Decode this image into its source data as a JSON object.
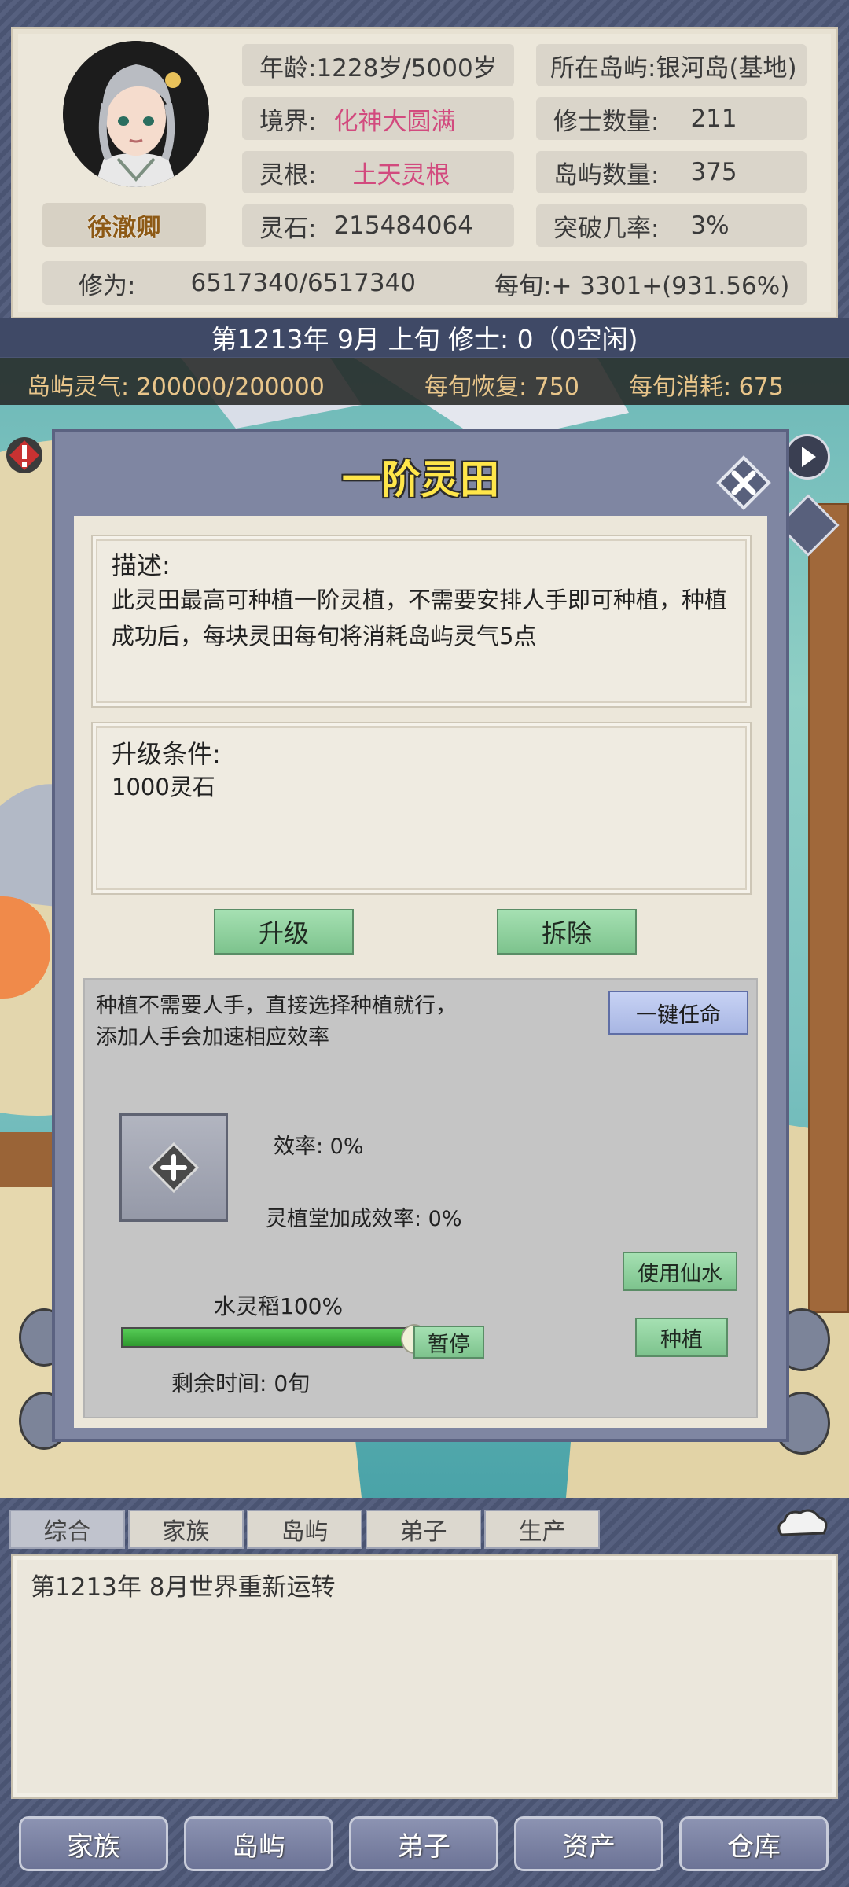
{
  "profile": {
    "name": "徐澈卿",
    "age": "年龄:1228岁/5000岁",
    "realm_label": "境界:",
    "realm_value": "化神大圆满",
    "root_label": "灵根:",
    "root_value": "土天灵根",
    "stones_label": "灵石:",
    "stones_value": "215484064",
    "island": "所在岛屿:银河岛(基地)",
    "cultivators_label": "修士数量:",
    "cultivators_value": "211",
    "islands_label": "岛屿数量:",
    "islands_value": "375",
    "breakthrough_label": "突破几率:",
    "breakthrough_value": "3%",
    "cultivation_label": "修为:",
    "cultivation_value": "6517340/6517340",
    "per_turn": "每旬:+ 3301+(931.56%)"
  },
  "date_line": "第1213年 9月 上旬    修士: 0（0空闲)",
  "island_stats": {
    "qi": "岛屿灵气: 200000/200000",
    "recover": "每旬恢复: 750",
    "consume": "每旬消耗: 675"
  },
  "modal": {
    "title": "一阶灵田",
    "desc_title": "描述:",
    "desc_text": "此灵田最高可种植一阶灵植，不需要安排人手即可种植，种植成功后，每块灵田每旬将消耗岛屿灵气5点",
    "upgrade_title": "升级条件:",
    "upgrade_text": "1000灵石",
    "upgrade_button": "升级",
    "demolish_button": "拆除",
    "hint_line1": "种植不需要人手，直接选择种植就行，",
    "hint_line2": "添加人手会加速相应效率",
    "oneclick_button": "一键任命",
    "efficiency": "效率: 0%",
    "hall_bonus": "灵植堂加成效率: 0%",
    "use_water_button": "使用仙水",
    "crop_progress_label": "水灵稻100%",
    "crop_progress": 1.0,
    "pause_button": "暂停",
    "plant_button": "种植",
    "remaining": "剩余时间: 0旬"
  },
  "log_tabs": [
    "综合",
    "家族",
    "岛屿",
    "弟子",
    "生产"
  ],
  "log_text": "第1213年 8月世界重新运转",
  "bottom_nav": [
    "家族",
    "岛屿",
    "弟子",
    "资产",
    "仓库"
  ],
  "colors": {
    "accent_pink": "#d24a7e",
    "title_yellow": "#ffe64a",
    "progress_green": "#3fae3f"
  }
}
